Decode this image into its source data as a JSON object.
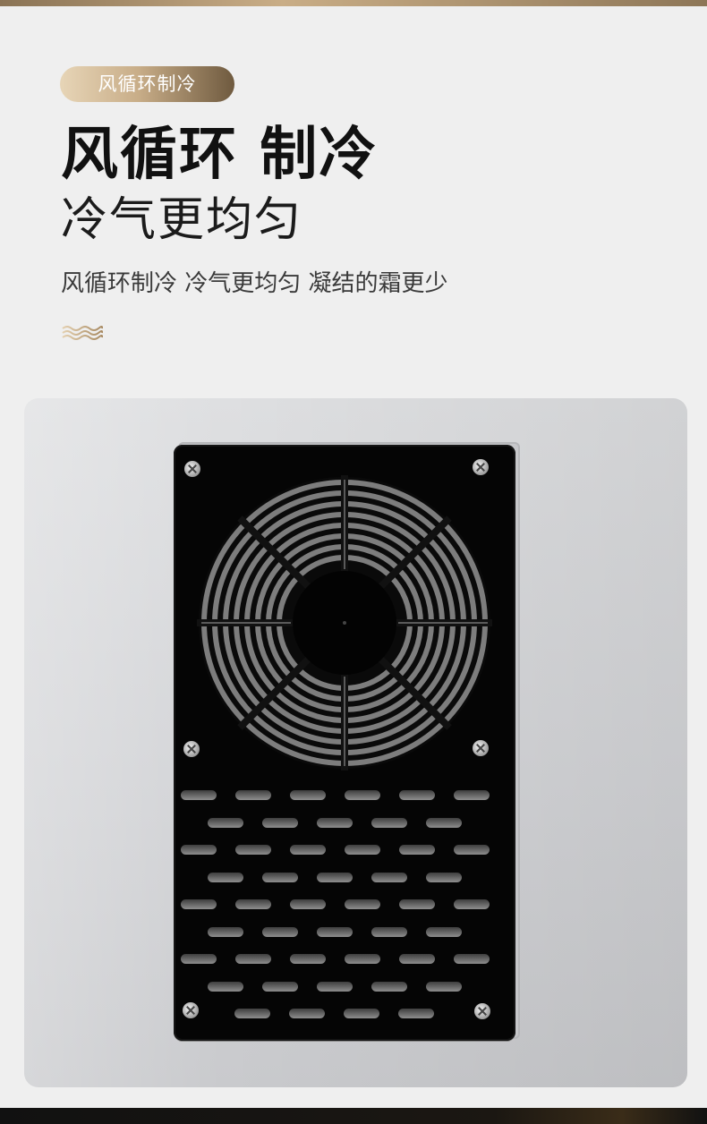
{
  "badge": {
    "label": "风循环制冷"
  },
  "headline": {
    "title": "风循环 制冷",
    "subtitle": "冷气更均匀",
    "description": "风循环制冷  冷气更均匀  凝结的霜更少"
  },
  "decoration": {
    "icon": "wave-lines-icon",
    "accent_color": "#c8ad88"
  },
  "product_photo": {
    "subject": "fan-vent-panel",
    "panel_color": "#050505",
    "body_color": "#d6d7da",
    "slot_rows": [
      6,
      5,
      6,
      5,
      6,
      5,
      6,
      5,
      4
    ]
  },
  "colors": {
    "background": "#efefef",
    "badge_gradient_start": "#e7d5b7",
    "badge_gradient_end": "#6f5a3f",
    "title": "#111111",
    "text": "#3a3a3a"
  }
}
